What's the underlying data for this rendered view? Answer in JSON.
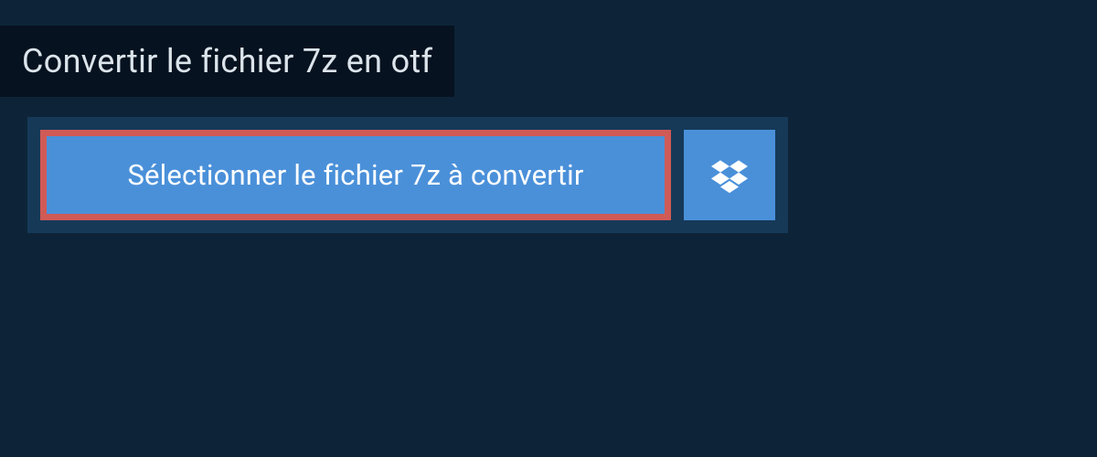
{
  "header": {
    "title": "Convertir le fichier 7z en otf"
  },
  "upload": {
    "select_button_label": "Sélectionner le fichier 7z à convertir"
  },
  "colors": {
    "background": "#0d2438",
    "header_bg": "#06121f",
    "panel_bg": "#163958",
    "button_bg": "#4a90d9",
    "highlight_border": "#d05a56",
    "text_light": "#dce4eb",
    "text_white": "#ffffff"
  }
}
